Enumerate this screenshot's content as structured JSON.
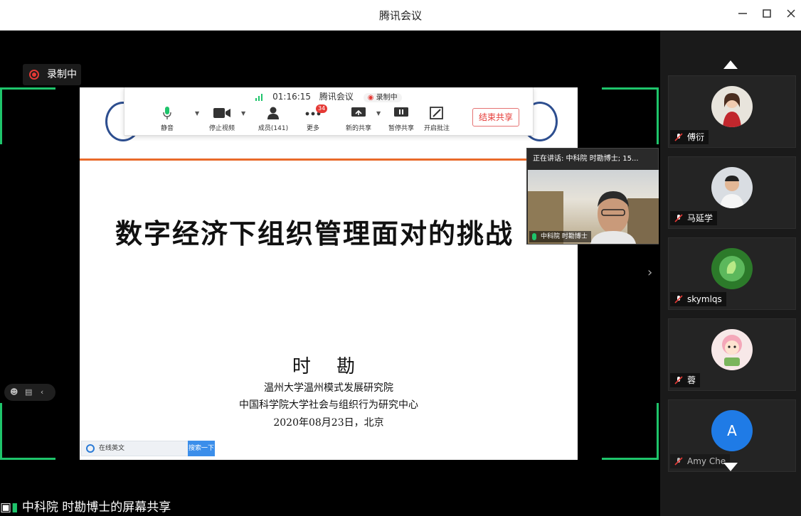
{
  "window": {
    "title": "腾讯会议",
    "minimize_icon": "minimize-icon",
    "maximize_icon": "maximize-icon",
    "close_icon": "close-icon"
  },
  "recording": {
    "label": "录制中"
  },
  "toolbar": {
    "timer": "01:16:15",
    "app_name": "腾讯会议",
    "recording_label": "录制中",
    "mute_label": "静音",
    "video_label": "停止视频",
    "members_label": "成员(141)",
    "more_label": "更多",
    "more_badge": "34",
    "new_share_label": "新的共享",
    "pause_share_label": "暂停共享",
    "annotate_label": "开启批注",
    "end_share_label": "结束共享"
  },
  "slide": {
    "title": "数字经济下组织管理面对的挑战",
    "author": "时 勘",
    "affiliation_1": "温州大学温州模式发展研究院",
    "affiliation_2": "中国科学院大学社会与组织行为研究中心",
    "date_place": "2020年08月23日，北京",
    "translate_placeholder": "在线英文",
    "translate_button": "搜索一下"
  },
  "speaker": {
    "header": "正在讲话: 中科院 时勘博士; 15...",
    "name": "中科院 时勘博士"
  },
  "share_label": "中科院 时勘博士的屏幕共享",
  "participants": [
    {
      "name": "傅衍"
    },
    {
      "name": "马延学"
    },
    {
      "name": "skymlqs"
    },
    {
      "name": "蓉"
    },
    {
      "name": "Amy Che",
      "initial": "A"
    }
  ],
  "colors": {
    "accent_green": "#1ec46b",
    "record_red": "#e53935",
    "avatar_blue": "#1f7be6"
  }
}
